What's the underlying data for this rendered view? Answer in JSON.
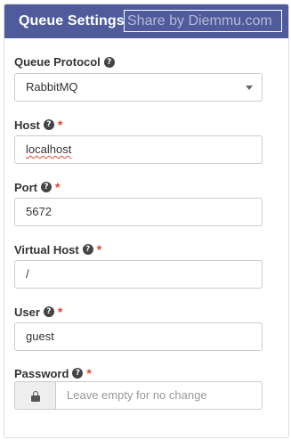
{
  "header": {
    "title": "Queue Settings",
    "watermark": "Share by Diemmu.com",
    "bg_color": "#4f5b9a"
  },
  "fields": {
    "queue_protocol": {
      "label": "Queue Protocol",
      "help_icon": "question-circle-icon",
      "value": "RabbitMQ",
      "required": false
    },
    "host": {
      "label": "Host",
      "help_icon": "question-circle-icon",
      "required_mark": "*",
      "value": "localhost"
    },
    "port": {
      "label": "Port",
      "help_icon": "question-circle-icon",
      "required_mark": "*",
      "value": "5672"
    },
    "virtual_host": {
      "label": "Virtual Host",
      "help_icon": "question-circle-icon",
      "required_mark": "*",
      "value": "/"
    },
    "user": {
      "label": "User",
      "help_icon": "question-circle-icon",
      "required_mark": "*",
      "value": "guest"
    },
    "password": {
      "label": "Password",
      "help_icon": "question-circle-icon",
      "required_mark": "*",
      "addon_icon": "lock-icon",
      "placeholder": "Leave empty for no change",
      "value": ""
    }
  },
  "colors": {
    "required": "#e2452e",
    "text": "#333333",
    "border": "#cccccc"
  }
}
